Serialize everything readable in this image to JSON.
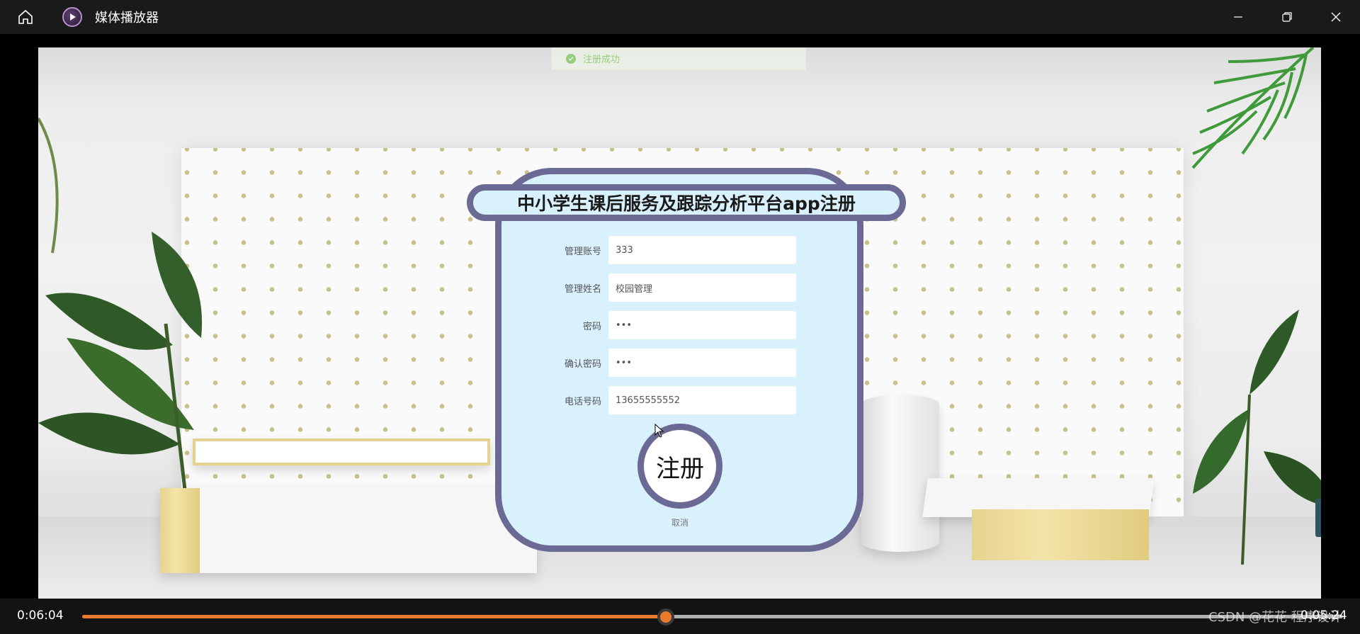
{
  "window": {
    "title": "媒体播放器",
    "icons": {
      "home": "home-icon",
      "app": "media-player-icon",
      "minimize": "minimize-icon",
      "restore": "restore-icon",
      "close": "close-icon"
    }
  },
  "toast": {
    "message": "注册成功",
    "icon": "check-circle-icon",
    "color": "#67c23a"
  },
  "form": {
    "title": "中小学生课后服务及跟踪分析平台app注册",
    "fields": [
      {
        "label": "管理账号",
        "value": "333"
      },
      {
        "label": "管理姓名",
        "value": "校园管理"
      },
      {
        "label": "密码",
        "value": "•••"
      },
      {
        "label": "确认密码",
        "value": "•••"
      },
      {
        "label": "电话号码",
        "value": "13655555552"
      }
    ],
    "submit_label": "注册",
    "cancel_label": "取消",
    "border_color": "#6b6a95",
    "card_color": "#d9f1fd"
  },
  "player": {
    "current_time": "0:06:04",
    "total_time": "0:05:24",
    "progress": 0.463,
    "accent_color": "#ec7a2d"
  },
  "watermark": "CSDN @花花 程序设计"
}
